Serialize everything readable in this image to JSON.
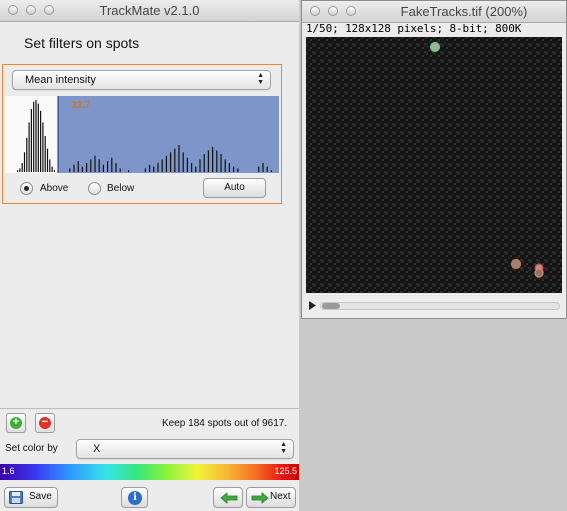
{
  "trackmate_window": {
    "title": "TrackMate v2.1.0",
    "panel_title": "Set filters on spots",
    "filter": {
      "feature": "Mean intensity",
      "threshold_label": "33.7",
      "above_label": "Above",
      "below_label": "Below",
      "selected_mode": "above",
      "auto_label": "Auto",
      "histogram_bins_left": [
        2,
        4,
        10,
        22,
        38,
        55,
        70,
        78,
        80,
        76,
        68,
        55,
        40,
        26,
        14,
        6,
        2
      ],
      "histogram_bins_right": [
        0,
        4,
        8,
        12,
        6,
        10,
        14,
        18,
        14,
        8,
        12,
        16,
        10,
        4,
        0,
        2,
        0,
        0,
        0,
        4,
        8,
        6,
        10,
        14,
        18,
        22,
        26,
        30,
        22,
        16,
        10,
        6,
        14,
        20,
        24,
        28,
        24,
        20,
        14,
        10,
        6,
        4,
        0,
        0,
        0,
        0,
        6,
        10,
        6,
        2
      ]
    },
    "status": {
      "keep_text": "Keep 184 spots out of  9617."
    },
    "color_by": {
      "label": "Set color by",
      "value": "X"
    },
    "colorbar": {
      "min": "1.6",
      "max": "125.5"
    },
    "buttons": {
      "save": "Save",
      "next": "Next"
    },
    "colors": {
      "accent_border": "#e8892b",
      "histogram_fill": "#7d95c9",
      "threshold_text": "#d4761a"
    }
  },
  "image_window": {
    "title": "FakeTracks.tif (200%)",
    "info": "1/50; 128x128 pixels; 8-bit; 800K"
  }
}
